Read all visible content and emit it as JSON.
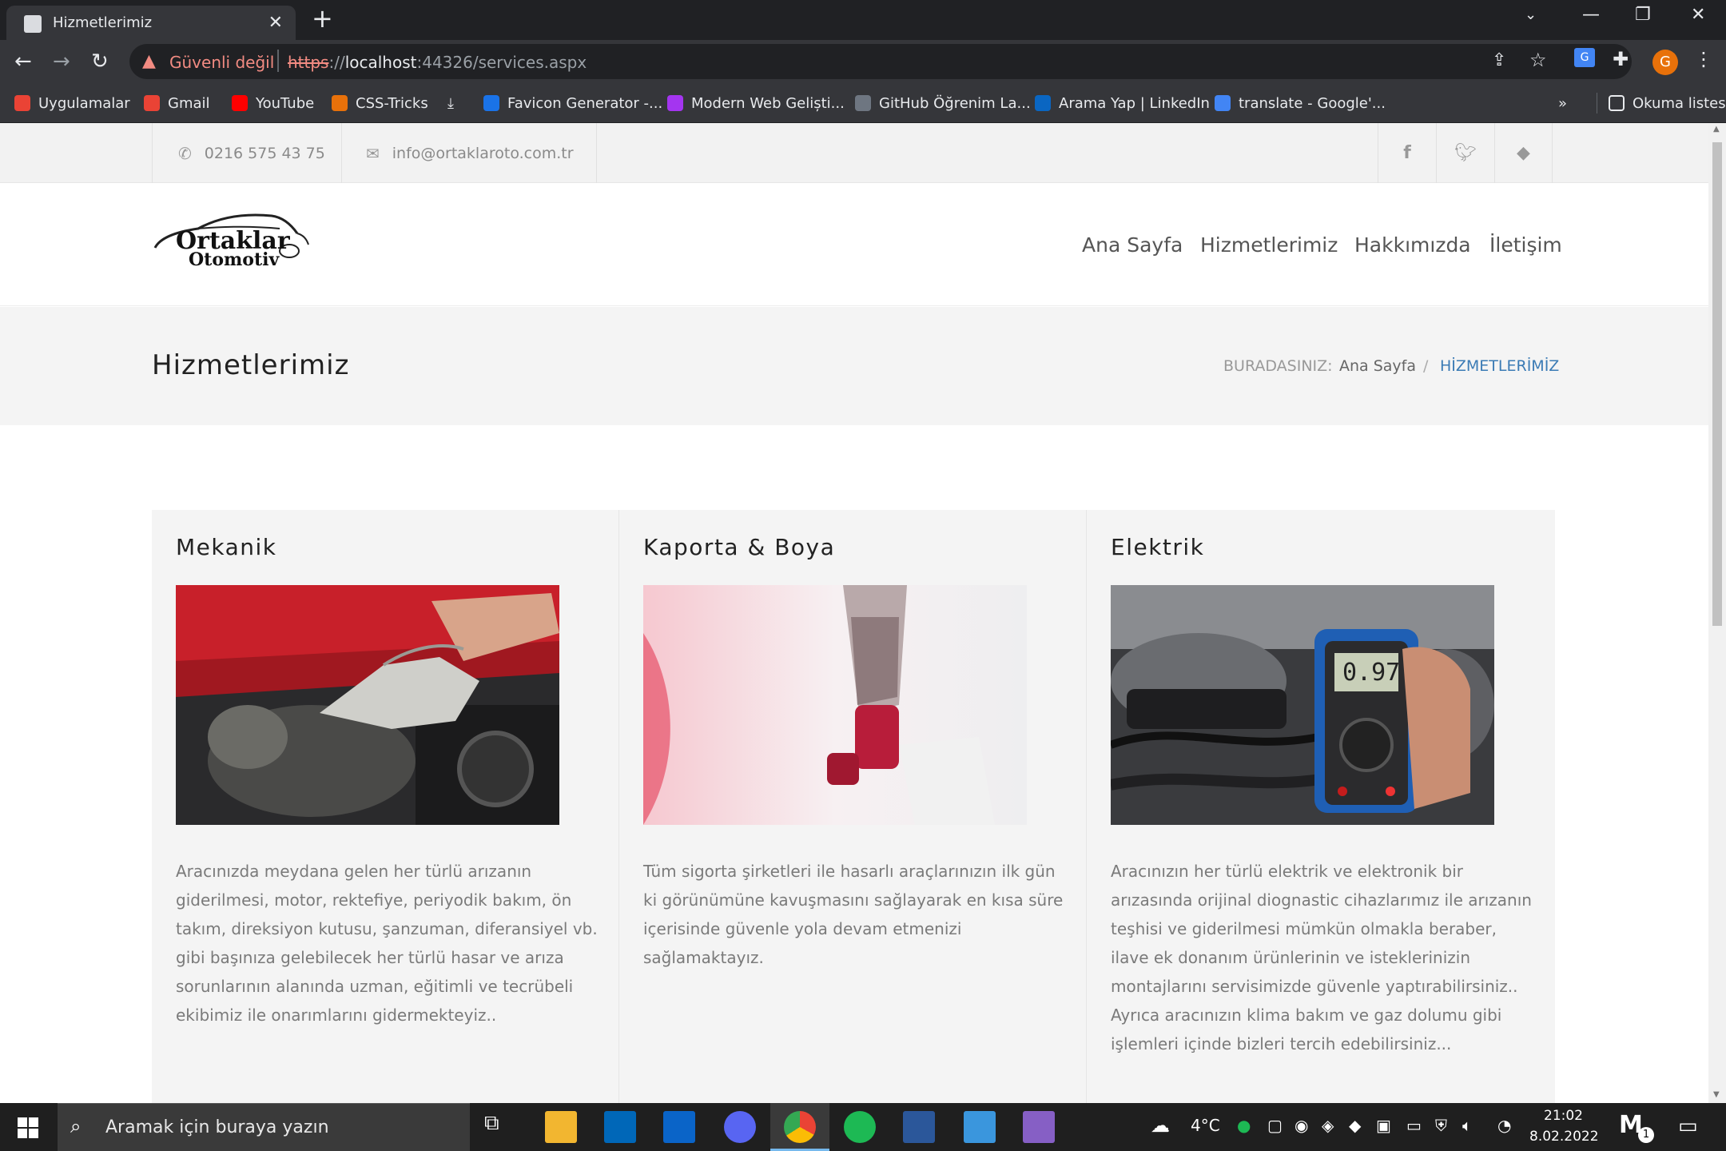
{
  "browser": {
    "tab_title": "Hizmetlerimiz",
    "insecure_label": "Güvenli değil",
    "url_scheme": "https",
    "url_sep": "://",
    "url_host": "localhost",
    "url_rest": ":44326/services.aspx",
    "profile_initial": "G",
    "bookmarks": [
      {
        "label": "Uygulamalar",
        "icon": "apps-grid-icon",
        "color": "#ea4335"
      },
      {
        "label": "Gmail",
        "icon": "gmail-icon",
        "color": "#ea4335"
      },
      {
        "label": "YouTube",
        "icon": "youtube-icon",
        "color": "#ff0000"
      },
      {
        "label": "CSS-Tricks",
        "icon": "css-tricks-icon",
        "color": "#e8710a"
      },
      {
        "label": "Favicon Generator -...",
        "icon": "favicon-generator-icon",
        "color": "#1a73e8"
      },
      {
        "label": "Modern Web Geliști...",
        "icon": "udemy-icon",
        "color": "#a435f0"
      },
      {
        "label": "GitHub Öğrenim La...",
        "icon": "github-icon",
        "color": "#6e7681"
      },
      {
        "label": "Arama Yap | LinkedIn",
        "icon": "linkedin-icon",
        "color": "#0a66c2"
      },
      {
        "label": "translate - Google'...",
        "icon": "google-icon",
        "color": "#4285f4"
      }
    ],
    "reading_list": "Okuma listesi",
    "more": "»"
  },
  "site": {
    "phone": "0216 575 43 75",
    "email": "info@ortaklaroto.com.tr",
    "logo_line1": "Ortaklar",
    "logo_line2": "Otomotiv",
    "menu": [
      "Ana Sayfa",
      "Hizmetlerimiz",
      "Hakkımızda",
      "İletişim"
    ],
    "page_title": "Hizmetlerimiz",
    "breadcrumb": {
      "prefix": "BURADASINIZ:",
      "home": "Ana Sayfa",
      "sep": "/",
      "current": "HİZMETLERİMİZ"
    },
    "services": [
      {
        "title": "Mekanik",
        "text": "Aracınızda meydana gelen her türlü arızanın giderilmesi, motor, rektefiye, periyodik bakım, ön takım, direksiyon kutusu, şanzuman, diferansiyel vb. gibi başınıza gelebilecek her türlü hasar ve arıza sorunlarının alanında uzman, eğitimli ve tecrübeli ekibimiz ile onarımlarını gidermekteyiz.."
      },
      {
        "title": "Kaporta & Boya",
        "text": "Tüm sigorta şirketleri ile hasarlı araçlarınızın ilk gün ki görünümüne kavuşmasını sağlayarak en kısa süre içerisinde güvenle yola devam etmenizi sağlamaktayız."
      },
      {
        "title": "Elektrik",
        "text": "Aracınızın her türlü elektrik ve elektronik bir arızasında orijinal diognastic cihazlarımız ile arızanın teşhisi ve giderilmesi mümkün olmakla beraber, ilave ek donanım ürünlerinin ve isteklerinizin montajlarını servisimizde güvenle yaptırabilirsiniz.. Ayrıca aracınızın klima bakım ve gaz dolumu gibi işlemleri içinde bizleri tercih edebilirsiniz..."
      }
    ],
    "multimeter_reading": "0.97",
    "colors": {
      "accent": "#3b7bb5",
      "topbar": "#f2f2f2",
      "section": "#f4f4f4"
    }
  },
  "taskbar": {
    "search_placeholder": "Aramak için buraya yazın",
    "weather": "4°C",
    "time": "21:02",
    "date": "8.02.2022",
    "notif_count": "1"
  }
}
